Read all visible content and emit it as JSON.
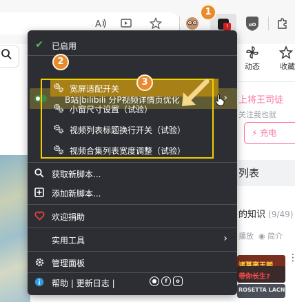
{
  "browser": {
    "toolbar_icons": [
      "read-aloud-icon",
      "immersive-reader-icon",
      "favorite-star-icon",
      "extension-puzzle-icon"
    ],
    "extensions": [
      "avatar-extension",
      "tampermonkey-extension",
      "shield-extension",
      "ublock-extension"
    ],
    "tampermonkey_badge": "1"
  },
  "menu": {
    "enabled_label": "已启用",
    "script_name": "B站|bilibili 分P视频详情页优化",
    "script_commands": [
      {
        "label": "宽屏适配开关",
        "highlighted": true
      },
      {
        "label": "小窗尺寸设置（试验）",
        "highlighted": false
      },
      {
        "label": "视频列表标题换行开关（试验）",
        "highlighted": false
      },
      {
        "label": "视频合集列表宽度调整（试验）",
        "highlighted": false
      }
    ],
    "get_new_script": "获取新脚本...",
    "add_new_script": "添加新脚本...",
    "donate": "欢迎捐助",
    "utilities": "实用工具",
    "dashboard": "管理面板",
    "help": "帮助",
    "separator": "|",
    "changelog": "更新日志",
    "footer_sep": "|",
    "footer_icons": [
      "github-icon",
      "facebook-icon",
      "instagram-icon"
    ]
  },
  "callouts": [
    "1",
    "2",
    "3"
  ],
  "page": {
    "nav_items": [
      "动态",
      "收藏"
    ],
    "uploader_name": "上将王司徒",
    "uploader_sub": "关注我也就",
    "charge_button": "充电",
    "list_title": "列表",
    "knowledge_title": "的知识",
    "knowledge_count": "(9/49)",
    "play_label": "播放",
    "intro_label": "简介",
    "thumb_texts": [
      "诸葛亮王朗",
      "带你长生?",
      "ROSETTA LACN"
    ]
  },
  "colors": {
    "menu_bg": "#2d2e33",
    "script_row_bg": "#615b33",
    "command_highlight": "#a88018",
    "annotation_yellow": "#f0d000",
    "callout_orange": "#e88a2e",
    "bilibili_pink": "#fb7299",
    "toggle_green": "#3d8c3f"
  }
}
